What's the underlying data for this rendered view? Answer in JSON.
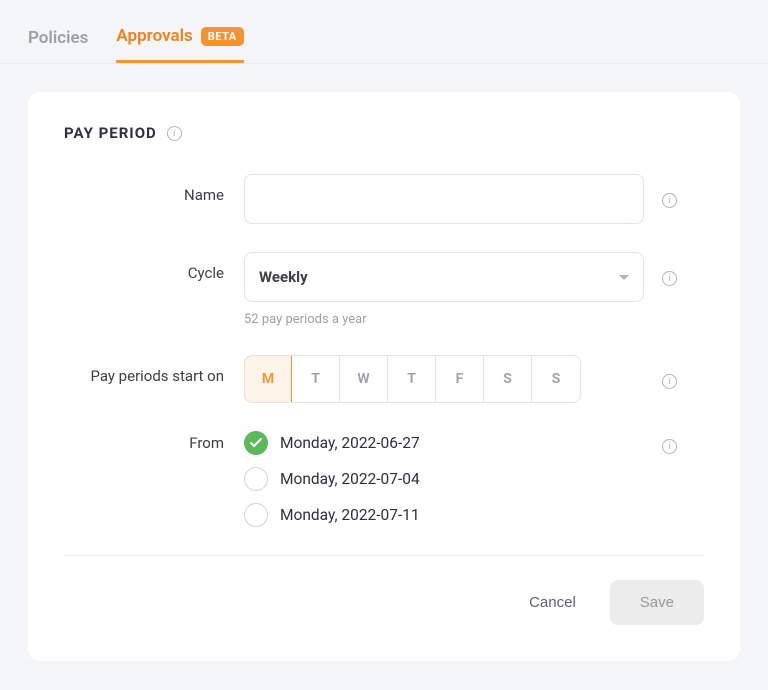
{
  "tabs": {
    "policies": "Policies",
    "approvals": "Approvals",
    "badge": "BETA"
  },
  "card": {
    "title": "PAY PERIOD"
  },
  "form": {
    "name": {
      "label": "Name",
      "value": ""
    },
    "cycle": {
      "label": "Cycle",
      "value": "Weekly",
      "helper": "52 pay periods a year"
    },
    "startOn": {
      "label": "Pay periods start on",
      "days": [
        "M",
        "T",
        "W",
        "T",
        "F",
        "S",
        "S"
      ],
      "selectedIndex": 0
    },
    "from": {
      "label": "From",
      "options": [
        "Monday, 2022-06-27",
        "Monday, 2022-07-04",
        "Monday, 2022-07-11"
      ],
      "selectedIndex": 0
    }
  },
  "actions": {
    "cancel": "Cancel",
    "save": "Save"
  }
}
